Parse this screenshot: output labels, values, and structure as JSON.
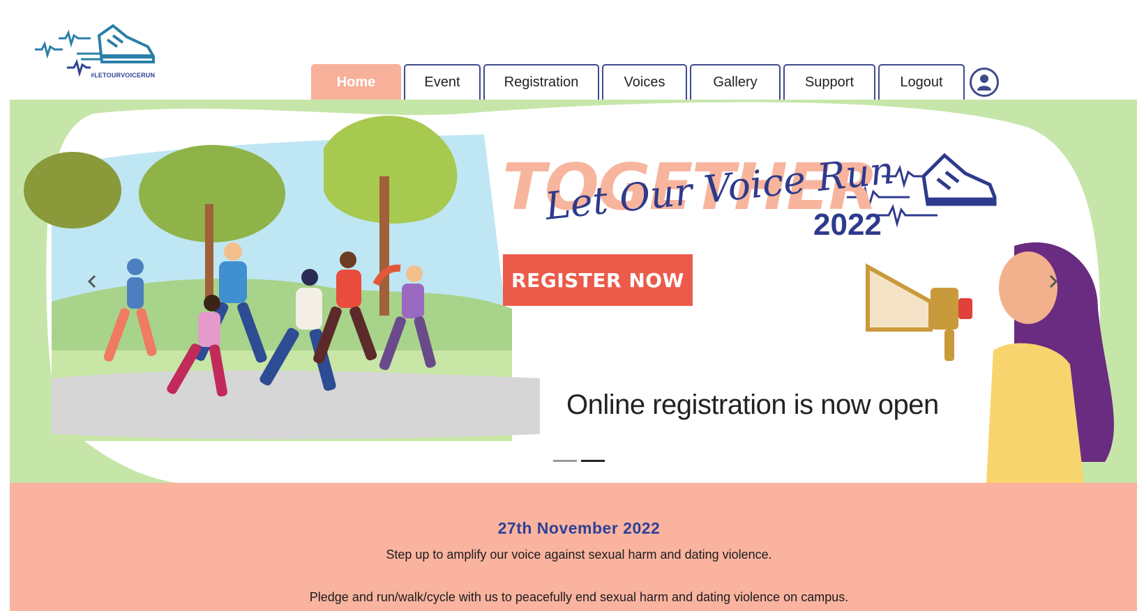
{
  "brand": {
    "tagline": "#LETOURVOICERUN"
  },
  "nav": {
    "items": [
      {
        "label": "Home"
      },
      {
        "label": "Event"
      },
      {
        "label": "Registration"
      },
      {
        "label": "Voices"
      },
      {
        "label": "Gallery"
      },
      {
        "label": "Support"
      },
      {
        "label": "Logout"
      }
    ],
    "active_index": 0
  },
  "hero": {
    "headline": "TOGETHER",
    "script_title": "Let Our Voice Run",
    "year": "2022",
    "cta_label": "REGISTER NOW",
    "caption": "Online registration is now open",
    "slides": 2,
    "active_slide": 1
  },
  "event": {
    "date": "27th November 2022",
    "line1": "Step up to amplify our voice against sexual harm and dating violence.",
    "line2": "Pledge and run/walk/cycle with us to peacefully end sexual harm and dating violence on campus."
  },
  "colors": {
    "nav_active": "#f7b19a",
    "nav_border": "#3e4a8a",
    "brand_blue": "#2e4096",
    "cta": "#ec5a4a",
    "peach": "#f9b39f",
    "hero_green": "#c6e6a9"
  }
}
